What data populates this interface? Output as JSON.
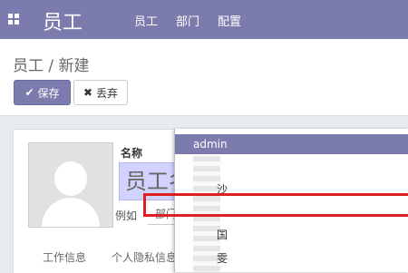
{
  "navbar": {
    "app_title": "员工",
    "menu": [
      "员工",
      "部门",
      "配置"
    ],
    "color": "#7c7bad"
  },
  "breadcrumb": {
    "text": "员工 / 新建"
  },
  "toolbar": {
    "save_label": "保存",
    "discard_label": "丢弃"
  },
  "form": {
    "name_label": "名称",
    "name_value": "员工名称",
    "example_label": "例如",
    "department_placeholder": "部门",
    "tabs": [
      "工作信息",
      "个人隐私信息"
    ]
  },
  "dropdown": {
    "selected_user": "admin",
    "items": [
      "沙",
      "国",
      "雯"
    ]
  },
  "highlight": {
    "color": "#e02020"
  }
}
